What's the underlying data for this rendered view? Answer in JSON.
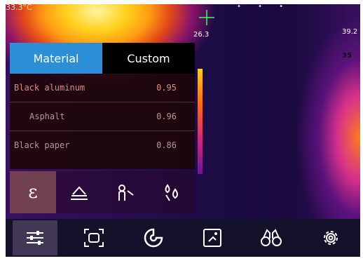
{
  "readouts": {
    "top_left_temp": "33.3°C",
    "center_temp": "26.3",
    "max_temp": "39.2",
    "side_temp": "35"
  },
  "material_panel": {
    "tabs": [
      {
        "label": "Material",
        "active": true
      },
      {
        "label": "Custom",
        "active": false
      }
    ],
    "items": [
      {
        "name": "Black aluminum",
        "value": "0.95"
      },
      {
        "name": "Asphalt",
        "value": "0.96"
      },
      {
        "name": "Black paper",
        "value": "0.86"
      }
    ]
  },
  "emissivity_toolbar": {
    "selected": "epsilon",
    "epsilon_symbol": "ε",
    "icons": [
      "epsilon-icon",
      "surface-icon",
      "distance-icon",
      "humidity-icon"
    ]
  },
  "bottom_toolbar": {
    "selected": "adjust",
    "icons": [
      "adjust-sliders-icon",
      "measurement-icon",
      "palette-icon",
      "image-icon",
      "binoculars-icon",
      "settings-gear-icon"
    ]
  },
  "colors": {
    "tab_active": "#2c8ed6",
    "tab_inactive": "#000000",
    "panel_background": "#1c0606",
    "toolbar_background": "#14122a"
  }
}
